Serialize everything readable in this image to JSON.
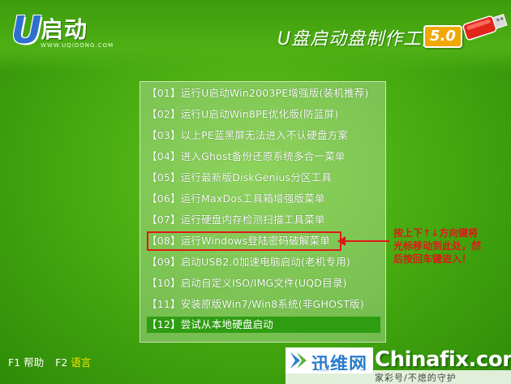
{
  "brand": {
    "logo_letter": "U",
    "logo_text": "启动",
    "logo_subtext": "WWW.UQIDONG.COM",
    "app_title": "U盘启动盘制作工具",
    "version": "5.0"
  },
  "menu": {
    "items": [
      {
        "label": "【01】运行U启动Win2003PE增强版(装机推荐)"
      },
      {
        "label": "【02】运行U启动Win8PE优化版(防蓝屏)"
      },
      {
        "label": "【03】以上PE蓝黑屏无法进入不认硬盘方案"
      },
      {
        "label": "【04】进入Ghost备份还原系统多合一菜单"
      },
      {
        "label": "【05】运行最新版DiskGenius分区工具"
      },
      {
        "label": "【06】运行MaxDos工具箱增强版菜单"
      },
      {
        "label": "【07】运行硬盘内存检测扫描工具菜单"
      },
      {
        "label": "【08】运行Windows登陆密码破解菜单"
      },
      {
        "label": "【09】启动USB2.0加速电脑启动(老机专用)"
      },
      {
        "label": "【10】启动自定义ISO/IMG文件(UQD目录)"
      },
      {
        "label": "【11】安装原版Win7/Win8系统(非GHOST版)"
      },
      {
        "label": "【12】尝试从本地硬盘启动"
      }
    ],
    "selected_index": 11,
    "annotated_index": 7
  },
  "annotation": {
    "line1": "按上下↑↓方向键将",
    "line2": "光标移动到此处，然",
    "line3": "后按回车键进入！",
    "color": "#e01818"
  },
  "fkeys": [
    {
      "key": "F1",
      "label": "帮助"
    },
    {
      "key": "F2",
      "label": "语言"
    }
  ],
  "watermark": {
    "left_text": "迅维网",
    "right_text": "Chinafix.com",
    "strip_text": "家彩号/不熄的守护"
  },
  "colors": {
    "background": "#43a70f",
    "selection": "#2f9d12",
    "version_badge": "#f0a800",
    "logo_blue": "#2f6fd0"
  }
}
